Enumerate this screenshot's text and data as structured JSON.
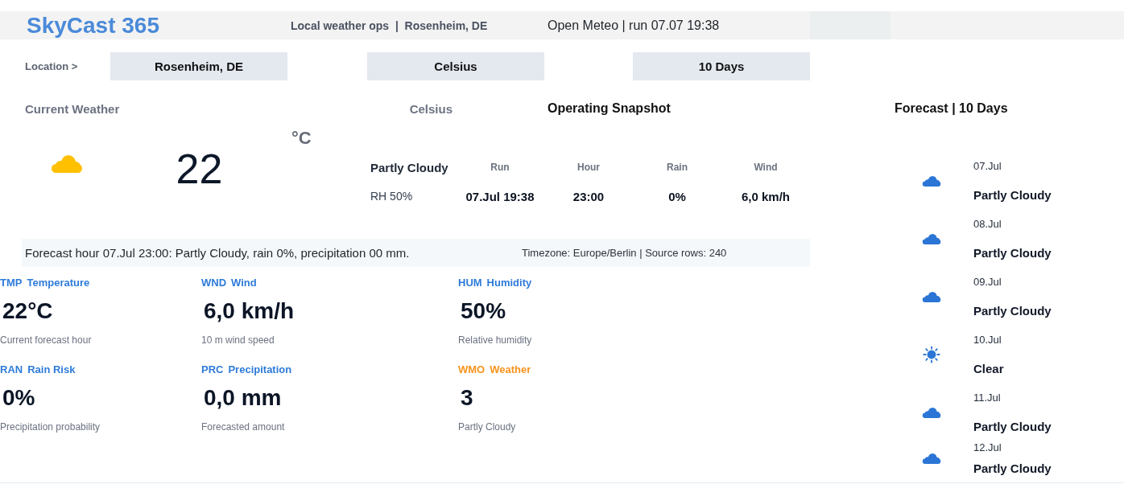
{
  "header": {
    "title": "SkyCast 365",
    "subtitle": "Local weather ops  |  Rosenheim, DE",
    "source": "Open Meteo | run 07.07 19:38"
  },
  "controls": {
    "label": "Location >",
    "selectors": [
      "Rosenheim, DE",
      "Celsius",
      "10 Days"
    ]
  },
  "current_weather": {
    "heading": "Current Weather",
    "unit_heading": "Celsius",
    "temperature": "22",
    "unit": "°C"
  },
  "snapshot": {
    "heading": "Operating Snapshot",
    "condition": "Partly Cloudy",
    "humidity": "RH 50%",
    "columns": [
      {
        "label": "Run",
        "value": "07.Jul 19:38"
      },
      {
        "label": "Hour",
        "value": "23:00"
      },
      {
        "label": "Rain",
        "value": "0%"
      },
      {
        "label": "Wind",
        "value": "6,0 km/h"
      }
    ]
  },
  "summary": {
    "text": "Forecast hour 07.Jul 23:00: Partly Cloudy, rain 0%, precipitation 00 mm.",
    "meta": "Timezone: Europe/Berlin | Source rows: 240"
  },
  "metrics": [
    {
      "code": "TMP",
      "label": "Temperature",
      "value": "22°C",
      "note": "Current forecast hour",
      "color": "#2e7bd9"
    },
    {
      "code": "WND",
      "label": "Wind",
      "value": "6,0 km/h",
      "note": "10 m wind speed",
      "color": "#2e7bd9"
    },
    {
      "code": "HUM",
      "label": "Humidity",
      "value": "50%",
      "note": "Relative humidity",
      "color": "#2e7bd9"
    },
    {
      "code": "RAN",
      "label": "Rain Risk",
      "value": "0%",
      "note": "Precipitation probability",
      "color": "#2e7bd9"
    },
    {
      "code": "PRC",
      "label": "Precipitation",
      "value": "0,0 mm",
      "note": "Forecasted amount",
      "color": "#2e7bd9"
    },
    {
      "code": "WMO",
      "label": "Weather",
      "value": "3",
      "note": "Partly Cloudy",
      "color": "#f7941d"
    }
  ],
  "forecast": {
    "heading": "Forecast | 10 Days",
    "days": [
      {
        "date": "07.Jul",
        "condition": "Partly Cloudy",
        "kind": "cloud"
      },
      {
        "date": "08.Jul",
        "condition": "Partly Cloudy",
        "kind": "cloud"
      },
      {
        "date": "09.Jul",
        "condition": "Partly Cloudy",
        "kind": "cloud"
      },
      {
        "date": "10.Jul",
        "condition": "Clear",
        "kind": "sun"
      },
      {
        "date": "11.Jul",
        "condition": "Partly Cloudy",
        "kind": "cloud"
      },
      {
        "date": "12.Jul",
        "condition": "Partly Cloudy",
        "kind": "cloud"
      }
    ]
  }
}
